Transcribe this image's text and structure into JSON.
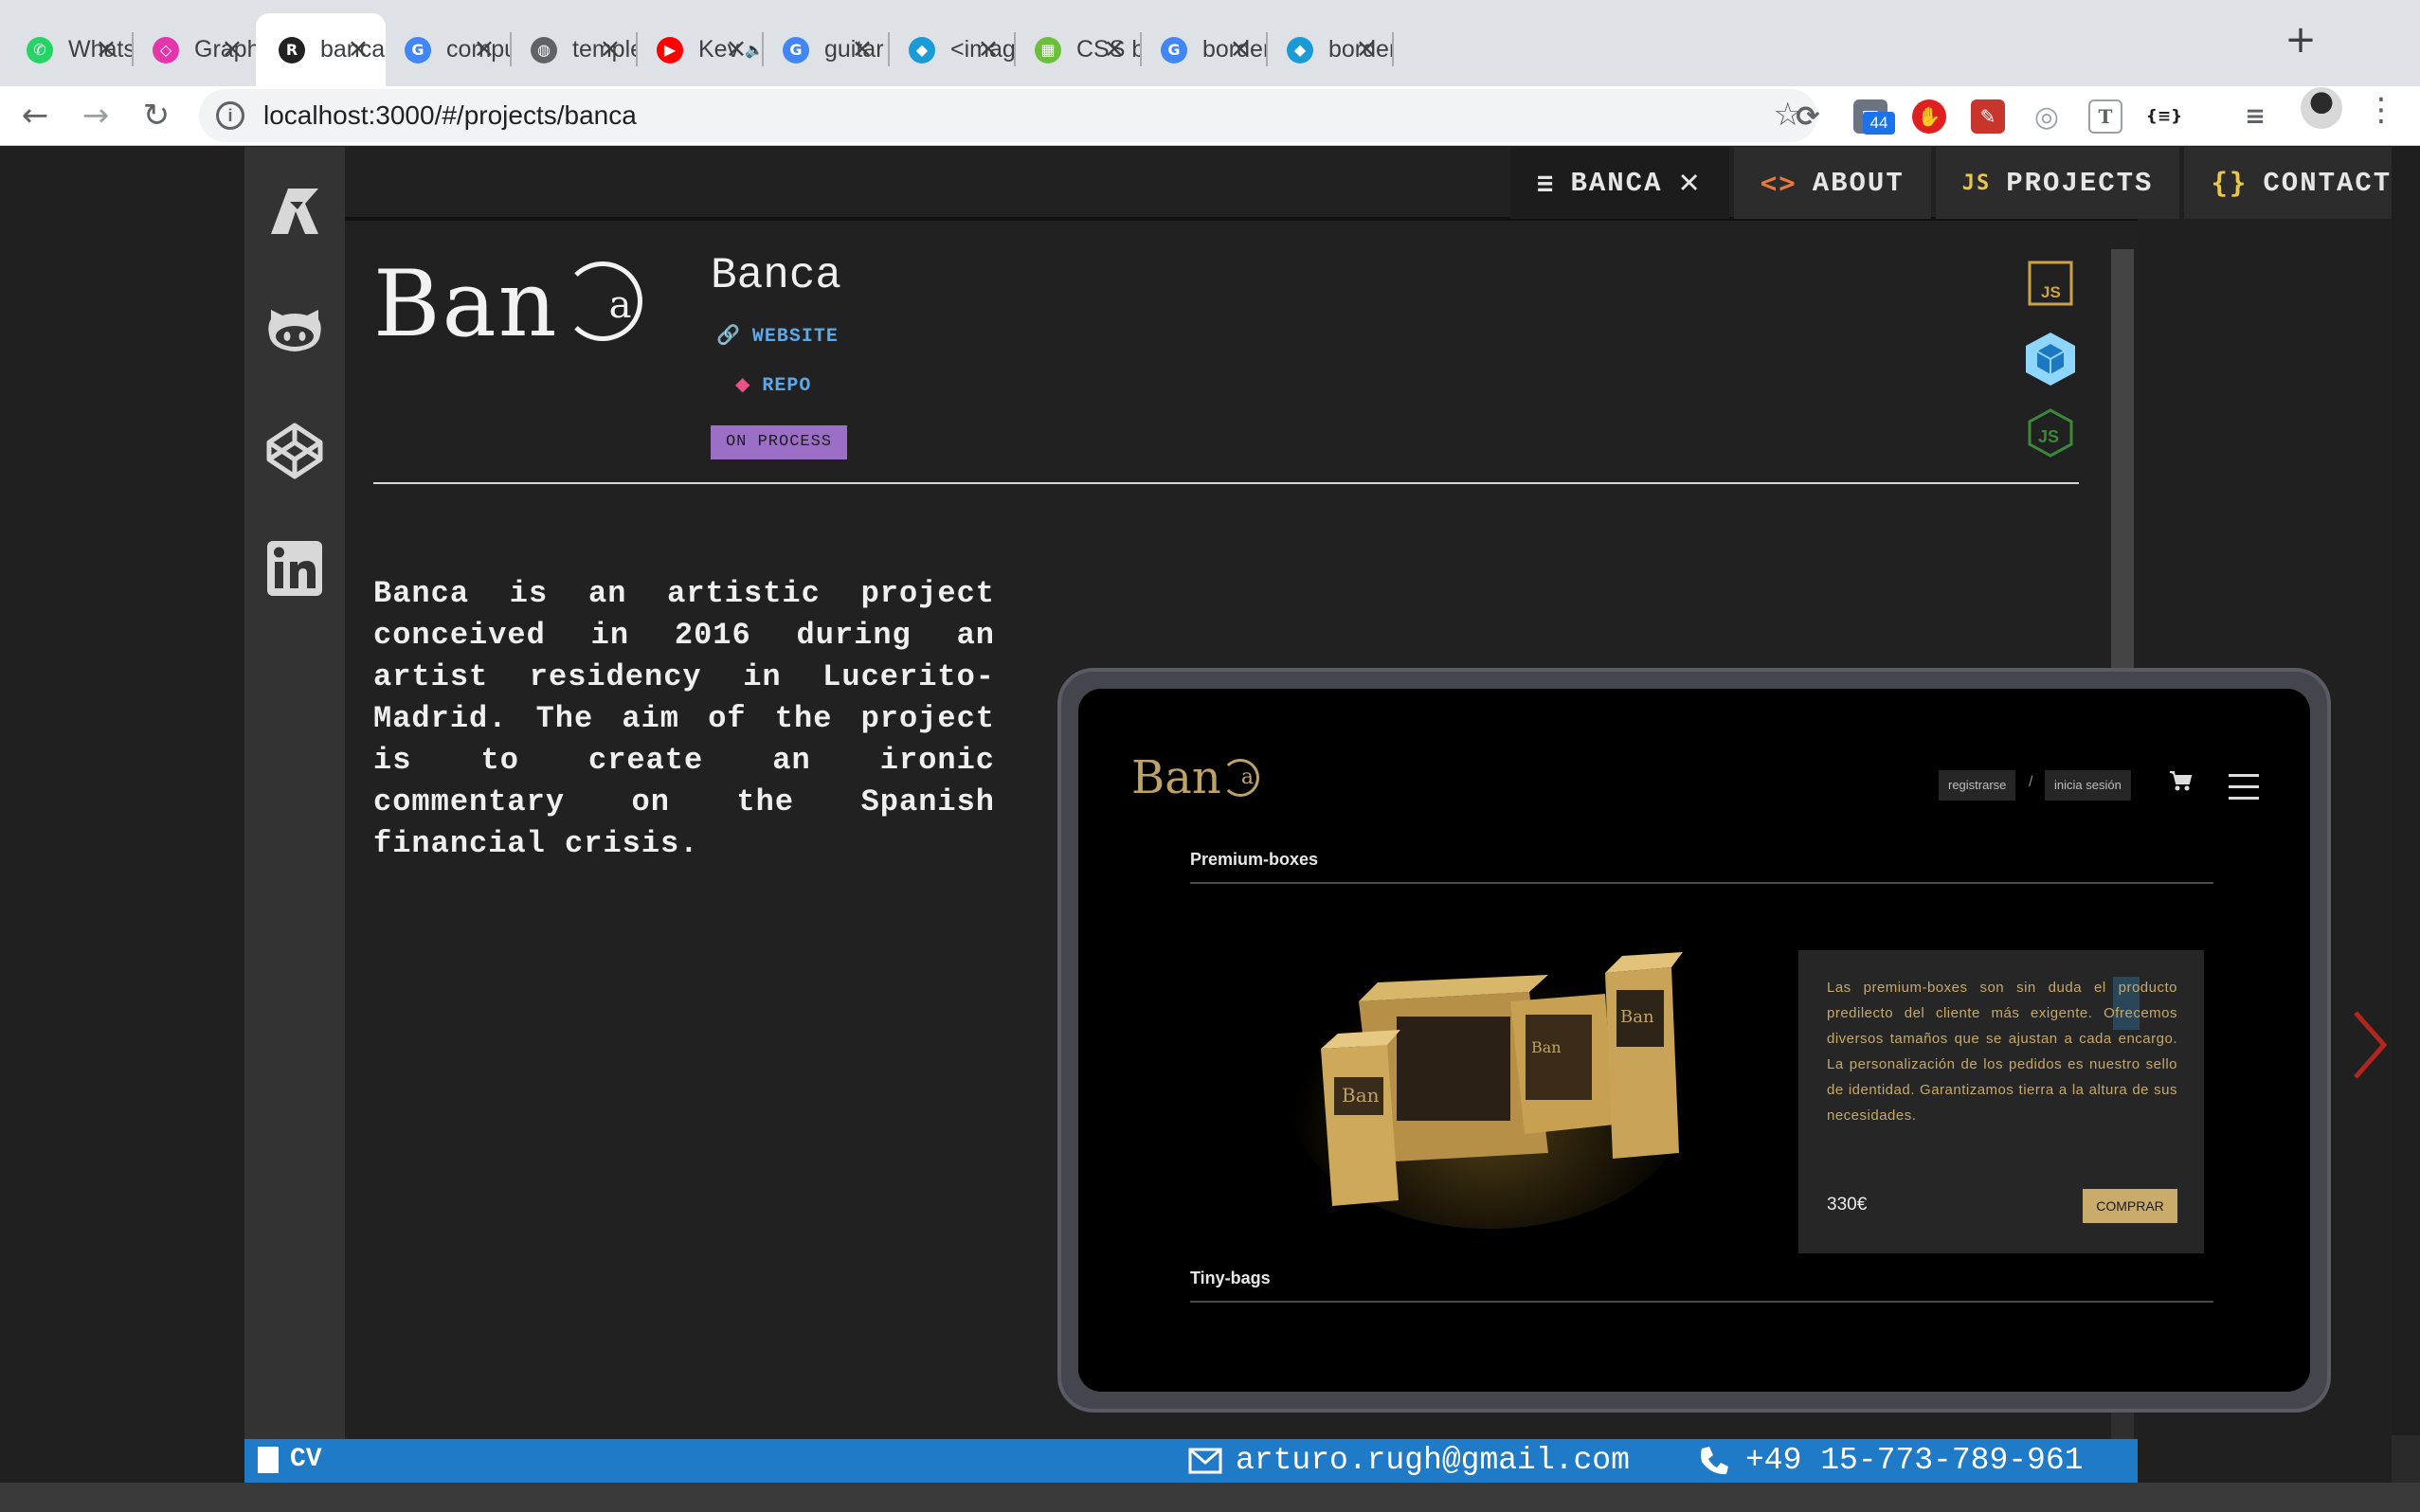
{
  "browser": {
    "tabs": [
      {
        "title": "WhatsA",
        "icon": "whatsapp-icon",
        "color": "#25d366"
      },
      {
        "title": "GraphQ",
        "icon": "graphql-icon",
        "color": "#e535ab"
      },
      {
        "title": "banca",
        "icon": "ar-logo-icon",
        "color": "#222222",
        "active": true
      },
      {
        "title": "comput",
        "icon": "google-icon",
        "color": "#4285f4"
      },
      {
        "title": "templet",
        "icon": "globe-icon",
        "color": "#5f6368"
      },
      {
        "title": "Kev",
        "icon": "youtube-icon",
        "color": "#ff0000",
        "audio": true
      },
      {
        "title": "guitar s",
        "icon": "google-icon",
        "color": "#4285f4"
      },
      {
        "title": "<image",
        "icon": "bird-icon",
        "color": "#1a9bd7"
      },
      {
        "title": "CSS ba",
        "icon": "cssbar-icon",
        "color": "#6bbf3c"
      },
      {
        "title": "border-",
        "icon": "google-icon",
        "color": "#4285f4"
      },
      {
        "title": "border-",
        "icon": "bird-icon",
        "color": "#1a9bd7"
      }
    ],
    "url": "localhost:3000/#/projects/banca",
    "extension_badge": "44"
  },
  "nav": {
    "tabs": [
      {
        "icon": "≡",
        "label": "BANCA",
        "closable": true,
        "icon_color": "#e6e6e6"
      },
      {
        "icon": "<>",
        "label": "ABOUT",
        "icon_color": "#e8793a"
      },
      {
        "icon": "JS",
        "label": "PROJECTS",
        "icon_color": "#e8c84a"
      },
      {
        "icon": "{}",
        "label": "CONTACT",
        "icon_color": "#e8c84a"
      }
    ],
    "close_glyph": "✕"
  },
  "project": {
    "logo_text": "Ban",
    "logo_small": "a",
    "title": "Banca",
    "website_label": "WEBSITE",
    "repo_label": "REPO",
    "status": "ON PROCESS",
    "description": "Banca is an artistic project conceived in 2016 during an artist residency in Lucerito-Madrid. The aim of the project is to create an ironic commentary on the Spanish financial crisis.",
    "tech": [
      "javascript-icon",
      "webpack-icon",
      "nodejs-icon"
    ]
  },
  "screenshot": {
    "logo": "Ban",
    "logo_small": "a",
    "register": "registrarse",
    "separator": "/",
    "login": "inicia sesión",
    "section1": "Premium-boxes",
    "section2": "Tiny-bags",
    "card_text": "Las premium-boxes son sin duda el producto predilecto del cliente más exigente. Ofrecemos diversos tamaños que se ajustan a cada encargo. La personalización de los pedidos es nuestro sello de identidad. Garantizamos tierra a la altura de sus necesidades.",
    "price": "330€",
    "buy": "COMPRAR",
    "box_label": "Ban"
  },
  "footer": {
    "cv": "CV",
    "email": "arturo.rugh@gmail.com",
    "phone": "+49 15-773-789-961",
    "color": "#1f7ac8"
  }
}
